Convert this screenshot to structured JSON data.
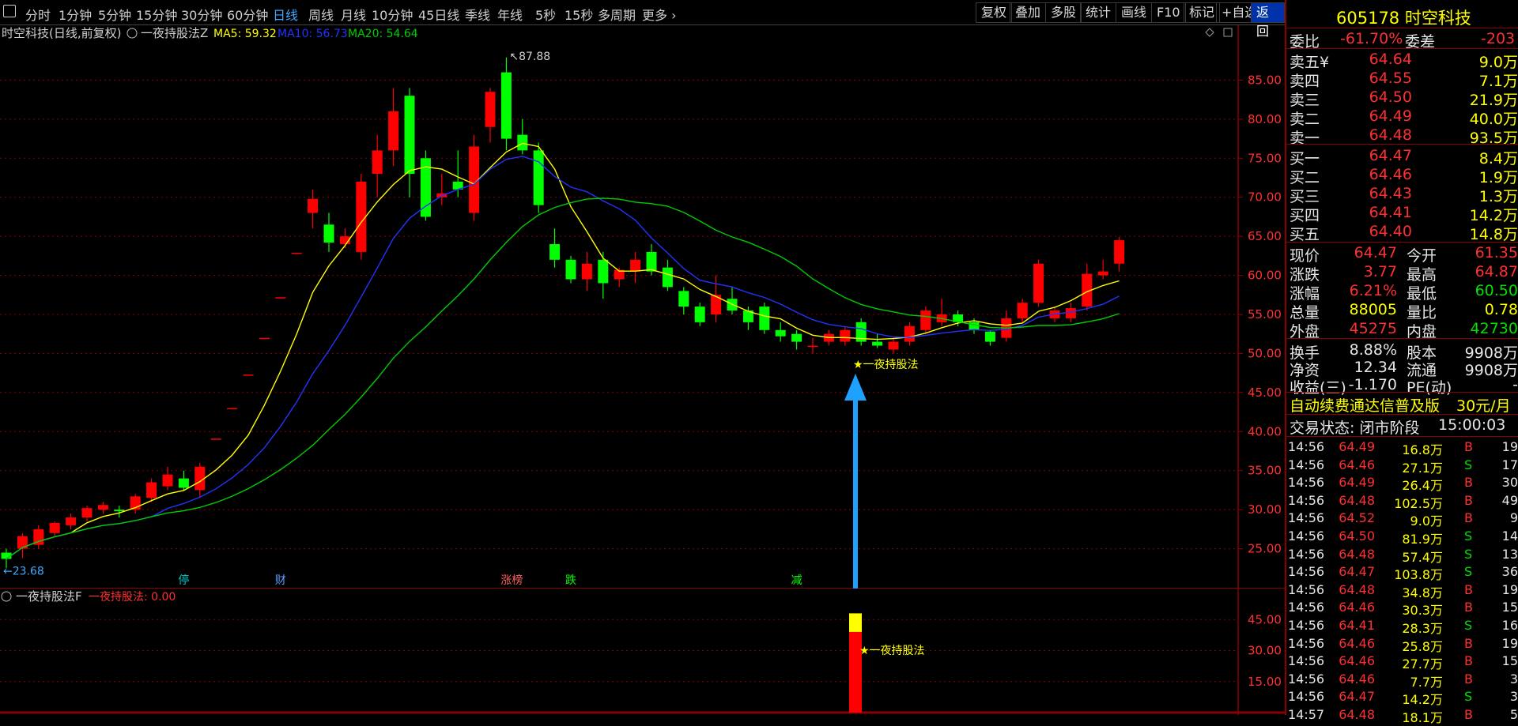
{
  "toolbar": {
    "left_items": [
      "分时",
      "1分钟",
      "5分钟",
      "15分钟",
      "30分钟",
      "60分钟",
      "日线",
      "周线",
      "月线",
      "10分钟",
      "45日线",
      "季线",
      "年线",
      "5秒",
      "15秒",
      "多周期",
      "更多"
    ],
    "active_item": "日线",
    "right_items": [
      "复权",
      "叠加",
      "多股",
      "统计",
      "画线",
      "F10",
      "标记",
      "+自选"
    ],
    "return_label": "返回"
  },
  "chart": {
    "title": "时空科技(日线,前复权)",
    "indicator_name": "一夜持股法Z",
    "ma5_label": "MA5: 59.32",
    "ma10_label": "MA10: 56.73",
    "ma20_label": "MA20: 54.64",
    "high_label": "87.88",
    "low_label": "23.68",
    "signal_label": "★一夜持股法",
    "price_ticks": [
      "85.00",
      "80.00",
      "75.00",
      "70.00",
      "65.00",
      "60.00",
      "55.00",
      "50.00",
      "45.00",
      "40.00",
      "35.00",
      "30.00",
      "25.00"
    ],
    "event_tags": [
      "停",
      "财",
      "涨榜",
      "跌",
      "减"
    ],
    "colors": {
      "up": "#ff0000",
      "down": "#00ff00",
      "ma5": "#ffff00",
      "ma10": "#2233ff",
      "ma20": "#00cc00",
      "grid": "#8b0000",
      "arrow": "#1ea0ff"
    }
  },
  "sub_chart": {
    "name": "一夜持股法F",
    "value_label": "一夜持股法: 0.00",
    "signal_label": "★一夜持股法",
    "ticks": [
      "45.00",
      "30.00",
      "15.00"
    ]
  },
  "chart_data": {
    "type": "candlestick",
    "price_range": [
      20,
      90
    ],
    "candles": [
      [
        24.5,
        25.0,
        22.5,
        23.7
      ],
      [
        25.0,
        27.0,
        23.8,
        26.6
      ],
      [
        25.5,
        28.0,
        25.0,
        27.5
      ],
      [
        27.0,
        28.5,
        26.5,
        28.3
      ],
      [
        28.0,
        29.5,
        27.5,
        29.0
      ],
      [
        29.0,
        30.5,
        28.5,
        30.2
      ],
      [
        30.0,
        31.0,
        29.5,
        30.6
      ],
      [
        30.0,
        30.5,
        29.0,
        29.8
      ],
      [
        30.0,
        32.0,
        29.5,
        31.7
      ],
      [
        31.5,
        34.0,
        31.0,
        33.5
      ],
      [
        33.0,
        35.5,
        32.5,
        34.5
      ],
      [
        34.0,
        35.0,
        32.5,
        32.8
      ],
      [
        32.5,
        36.0,
        31.5,
        35.5
      ],
      [
        39.1,
        39.1,
        39.1,
        39.1
      ],
      [
        43.0,
        43.0,
        43.0,
        43.0
      ],
      [
        47.3,
        47.3,
        47.3,
        47.3
      ],
      [
        52.0,
        52.0,
        52.0,
        52.0
      ],
      [
        57.2,
        57.2,
        57.2,
        57.2
      ],
      [
        62.9,
        62.9,
        62.9,
        62.9
      ],
      [
        68.0,
        71.0,
        66.0,
        69.8
      ],
      [
        66.5,
        68.0,
        63.0,
        64.2
      ],
      [
        64.0,
        66.0,
        63.5,
        65.0
      ],
      [
        63.0,
        73.0,
        62.0,
        72.0
      ],
      [
        73.0,
        78.0,
        70.0,
        76.0
      ],
      [
        76.0,
        84.0,
        74.0,
        81.0
      ],
      [
        83.0,
        84.0,
        70.0,
        73.0
      ],
      [
        75.0,
        76.0,
        67.0,
        67.5
      ],
      [
        70.0,
        73.0,
        69.0,
        70.5
      ],
      [
        72.0,
        76.0,
        70.0,
        71.0
      ],
      [
        68.0,
        78.0,
        67.0,
        76.5
      ],
      [
        79.0,
        84.0,
        77.0,
        83.5
      ],
      [
        86.0,
        87.9,
        76.0,
        77.5
      ],
      [
        78.0,
        80.0,
        75.5,
        76.0
      ],
      [
        76.0,
        77.0,
        68.0,
        69.0
      ],
      [
        64.0,
        66.0,
        61.0,
        62.0
      ],
      [
        62.0,
        62.5,
        59.0,
        59.5
      ],
      [
        59.5,
        63.0,
        58.0,
        61.5
      ],
      [
        62.0,
        63.0,
        57.0,
        59.0
      ],
      [
        59.5,
        61.0,
        58.5,
        60.7
      ],
      [
        60.5,
        63.0,
        59.0,
        62.0
      ],
      [
        63.0,
        64.0,
        60.0,
        60.5
      ],
      [
        61.0,
        62.0,
        58.0,
        58.5
      ],
      [
        58.0,
        58.5,
        55.0,
        56.0
      ],
      [
        56.0,
        56.5,
        53.5,
        54.0
      ],
      [
        55.0,
        60.0,
        54.0,
        57.5
      ],
      [
        57.0,
        58.5,
        55.0,
        55.5
      ],
      [
        55.5,
        56.0,
        53.0,
        54.0
      ],
      [
        56.0,
        56.5,
        52.5,
        53.0
      ],
      [
        53.0,
        54.0,
        51.5,
        52.2
      ],
      [
        52.5,
        53.0,
        50.5,
        51.5
      ],
      [
        51.0,
        52.0,
        50.0,
        51.0
      ],
      [
        51.5,
        53.0,
        51.0,
        52.5
      ],
      [
        51.5,
        53.5,
        51.0,
        53.0
      ],
      [
        54.0,
        54.5,
        51.0,
        51.5
      ],
      [
        51.5,
        52.5,
        50.7,
        51.0
      ],
      [
        50.5,
        52.0,
        50.0,
        51.5
      ],
      [
        51.5,
        54.0,
        51.0,
        53.5
      ],
      [
        53.0,
        56.0,
        52.5,
        55.5
      ],
      [
        54.0,
        57.0,
        53.5,
        55.0
      ],
      [
        55.0,
        55.5,
        53.5,
        54.0
      ],
      [
        54.0,
        54.5,
        52.5,
        53.0
      ],
      [
        52.8,
        53.0,
        51.0,
        51.5
      ],
      [
        52.0,
        55.5,
        51.5,
        54.5
      ],
      [
        54.5,
        57.0,
        54.0,
        56.5
      ],
      [
        56.5,
        62.0,
        56.0,
        61.5
      ],
      [
        54.5,
        56.0,
        54.0,
        55.5
      ],
      [
        54.5,
        56.5,
        54.0,
        55.8
      ],
      [
        56.0,
        61.5,
        55.5,
        60.2
      ],
      [
        60.0,
        62.0,
        59.5,
        60.5
      ],
      [
        61.5,
        64.9,
        60.5,
        64.5
      ]
    ],
    "signal_value": 48
  },
  "quote": {
    "code_name": "605178 时空科技",
    "weibi_label": "委比",
    "weibi_value": "-61.70%",
    "weicha_label": "委差",
    "weicha_value": "-203",
    "asks": [
      {
        "label": "卖五",
        "price": "64.64",
        "vol": "9.0万"
      },
      {
        "label": "卖四",
        "price": "64.55",
        "vol": "7.1万"
      },
      {
        "label": "卖三",
        "price": "64.50",
        "vol": "21.9万"
      },
      {
        "label": "卖二",
        "price": "64.49",
        "vol": "40.0万"
      },
      {
        "label": "卖一",
        "price": "64.48",
        "vol": "93.5万"
      }
    ],
    "ask_mark": "¥",
    "bids": [
      {
        "label": "买一",
        "price": "64.47",
        "vol": "8.4万"
      },
      {
        "label": "买二",
        "price": "64.46",
        "vol": "1.9万"
      },
      {
        "label": "买三",
        "price": "64.43",
        "vol": "1.3万"
      },
      {
        "label": "买四",
        "price": "64.41",
        "vol": "14.2万"
      },
      {
        "label": "买五",
        "price": "64.40",
        "vol": "14.8万"
      }
    ],
    "stats": [
      {
        "l1": "现价",
        "v1": "64.47",
        "c1": "red",
        "l2": "今开",
        "v2": "61.35",
        "c2": "red"
      },
      {
        "l1": "涨跌",
        "v1": "3.77",
        "c1": "red",
        "l2": "最高",
        "v2": "64.87",
        "c2": "red"
      },
      {
        "l1": "涨幅",
        "v1": "6.21%",
        "c1": "red",
        "l2": "最低",
        "v2": "60.50",
        "c2": "green"
      },
      {
        "l1": "总量",
        "v1": "88005",
        "c1": "yellow",
        "l2": "量比",
        "v2": "0.78",
        "c2": "yellow"
      },
      {
        "l1": "外盘",
        "v1": "45275",
        "c1": "red",
        "l2": "内盘",
        "v2": "42730",
        "c2": "green"
      }
    ],
    "stats2": [
      {
        "l1": "换手",
        "v1": "8.88%",
        "l2": "股本",
        "v2": "9908万"
      },
      {
        "l1": "净资",
        "v1": "12.34",
        "l2": "流通",
        "v2": "9908万"
      },
      {
        "l1": "收益(三)",
        "v1": "-1.170",
        "l2": "PE(动)",
        "v2": "-"
      }
    ],
    "promo": "自动续费通达信普及版",
    "promo_price": "30元/月",
    "status_label": "交易状态: 闭市阶段",
    "status_time": "15:00:03"
  },
  "ticks": [
    [
      "14:56",
      "64.49",
      "16.8万",
      "B",
      "19"
    ],
    [
      "14:56",
      "64.46",
      "27.1万",
      "S",
      "17"
    ],
    [
      "14:56",
      "64.49",
      "26.4万",
      "B",
      "30"
    ],
    [
      "14:56",
      "64.48",
      "102.5万",
      "B",
      "49"
    ],
    [
      "14:56",
      "64.52",
      "9.0万",
      "B",
      "9"
    ],
    [
      "14:56",
      "64.50",
      "81.9万",
      "S",
      "14"
    ],
    [
      "14:56",
      "64.48",
      "57.4万",
      "S",
      "13"
    ],
    [
      "14:56",
      "64.47",
      "103.8万",
      "S",
      "36"
    ],
    [
      "14:56",
      "64.48",
      "34.8万",
      "B",
      "19"
    ],
    [
      "14:56",
      "64.46",
      "30.3万",
      "B",
      "15"
    ],
    [
      "14:56",
      "64.41",
      "28.3万",
      "S",
      "16"
    ],
    [
      "14:56",
      "64.46",
      "25.8万",
      "B",
      "19"
    ],
    [
      "14:56",
      "64.46",
      "27.7万",
      "B",
      "15"
    ],
    [
      "14:56",
      "64.46",
      "7.7万",
      "B",
      "3"
    ],
    [
      "14:56",
      "64.47",
      "14.2万",
      "S",
      "3"
    ],
    [
      "14:57",
      "64.48",
      "18.1万",
      "B",
      "5"
    ]
  ]
}
